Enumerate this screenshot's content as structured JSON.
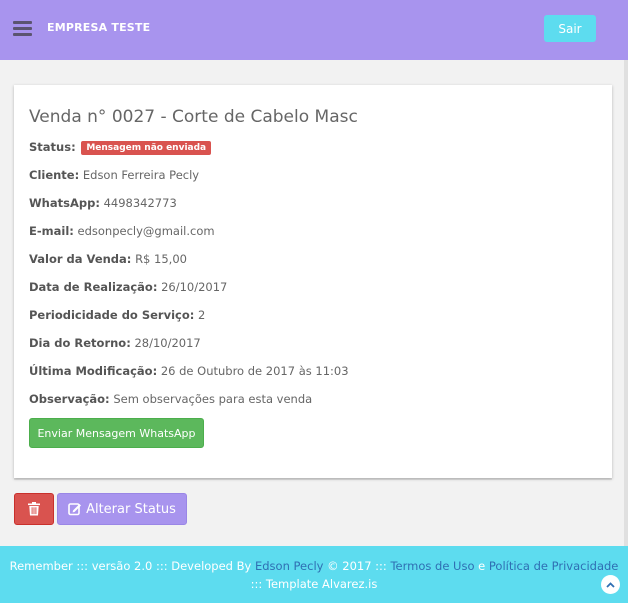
{
  "navbar": {
    "brand": "EMPRESA TESTE",
    "logout_label": "Sair"
  },
  "sale": {
    "title": "Venda n° 0027 - Corte de Cabelo Masc",
    "status_label": "Status:",
    "status_badge": "Mensagem não enviada",
    "fields": [
      {
        "label": "Cliente:",
        "value": "Edson Ferreira Pecly"
      },
      {
        "label": "WhatsApp:",
        "value": "4498342773"
      },
      {
        "label": "E-mail:",
        "value": "edsonpecly@gmail.com"
      },
      {
        "label": "Valor da Venda:",
        "value": "R$ 15,00"
      },
      {
        "label": "Data de Realização:",
        "value": "26/10/2017"
      },
      {
        "label": "Periodicidade do Serviço:",
        "value": "2"
      },
      {
        "label": "Dia do Retorno:",
        "value": "28/10/2017"
      },
      {
        "label": "Última Modificação:",
        "value": "26 de Outubro de 2017 às 11:03"
      },
      {
        "label": "Observação:",
        "value": "Sem observações para esta venda"
      }
    ],
    "whatsapp_button": "Enviar Mensagem WhatsApp"
  },
  "actions": {
    "change_status_label": "Alterar Status"
  },
  "footer": {
    "prefix": "Remember ::: versão 2.0 ::: Developed By ",
    "author_link": "Edson Pecly",
    "middle": " © 2017 ::: ",
    "terms_link": "Termos de Uso",
    "conj": " e ",
    "privacy_link": "Política de Privacidade",
    "line2": "::: Template Alvarez.is"
  },
  "colors": {
    "navbar": "#a894ee",
    "accent_cyan": "#5ddcef",
    "danger": "#d9534f",
    "success": "#5cb85c"
  }
}
